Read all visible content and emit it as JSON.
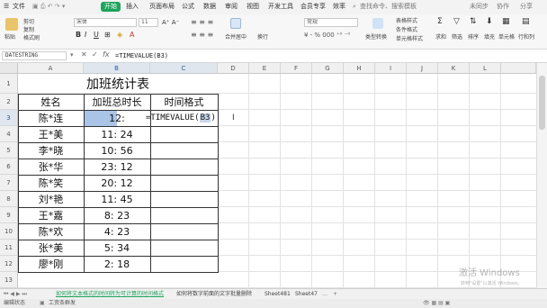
{
  "menu": {
    "items": [
      "文件",
      "开始",
      "插入",
      "页面布局",
      "公式",
      "数据",
      "审阅",
      "视图",
      "开发工具",
      "会员专享",
      "效率"
    ],
    "search_placeholder": "查找命令、搜索模板",
    "sync_label": "未同步",
    "collab_label": "协作",
    "share_label": "分享"
  },
  "ribbon": {
    "paste": "粘贴",
    "cut": "剪切",
    "copy": "复制",
    "format_painter": "格式刷",
    "font_name": "宋体",
    "font_size": "11",
    "number_format": "常规",
    "table_style": "表格样式",
    "cond_format": "条件格式",
    "cell_style": "单元格样式",
    "sum": "求和",
    "filter": "筛选",
    "sort": "排序",
    "fill": "填充",
    "cell": "单元格",
    "row_col": "行和列",
    "worksheet": "工作表",
    "freeze": "冻结窗格",
    "table_tools": "表格工具",
    "find": "查找",
    "symbol": "符号",
    "wrap": "换行",
    "type_convert": "类型转换",
    "merge_center": "合并居中"
  },
  "formula_bar": {
    "name_box": "DATESTRING",
    "content": "=TIMEVALUE(B3)"
  },
  "columns": [
    "A",
    "B",
    "C",
    "D",
    "E",
    "F",
    "G",
    "H",
    "I",
    "J",
    "K",
    "L"
  ],
  "rows": [
    "1",
    "2",
    "3",
    "4",
    "5",
    "6",
    "7",
    "8",
    "9",
    "10",
    "11",
    "12",
    "13"
  ],
  "table": {
    "title": "加班统计表",
    "headers": [
      "姓名",
      "加班总时长",
      "时间格式"
    ],
    "records": [
      {
        "name": "陈*连",
        "duration": "12:"
      },
      {
        "name": "王*美",
        "duration": "11: 24"
      },
      {
        "name": "李*晓",
        "duration": "10: 56"
      },
      {
        "name": "张*华",
        "duration": "23: 12"
      },
      {
        "name": "陈*笑",
        "duration": "20: 12"
      },
      {
        "name": "刘*艳",
        "duration": "11: 45"
      },
      {
        "name": "王*嘉",
        "duration": "8: 23"
      },
      {
        "name": "陈*欢",
        "duration": "4: 23"
      },
      {
        "name": "张*美",
        "duration": "5: 34"
      },
      {
        "name": "廖*刚",
        "duration": "2: 18"
      }
    ],
    "editing_formula_prefix": "=TIMEVALUE(",
    "editing_formula_ref": "B3",
    "editing_formula_suffix": ")"
  },
  "sheet_tabs": {
    "active": "如何将文本格式的时间转为可计算的时间格式",
    "others": [
      "如何将数字前面的文字批量删除",
      "Sheet481",
      "Sheet47"
    ]
  },
  "status_bar": {
    "mode": "编辑状态",
    "assistant": "工资条群发"
  },
  "watermark": {
    "line1": "激活 Windows",
    "line2": "转到\"设置\"以激活 Windows。"
  },
  "colors": {
    "accent": "#1fa35d",
    "selection": "#a9c4e6",
    "formula_ref": "#c9d6ea"
  }
}
